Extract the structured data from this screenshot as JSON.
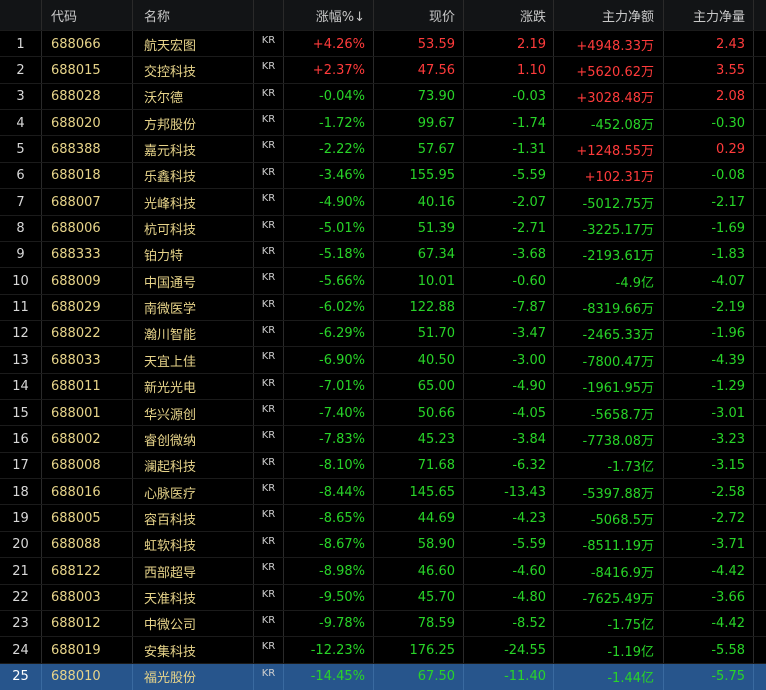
{
  "colors": {
    "up": "#ff3b3b",
    "down": "#28d428",
    "code": "#e7d48a",
    "selected_row": "#27558c",
    "background": "#000000"
  },
  "header": {
    "code": "代码",
    "name": "名称",
    "pct": "涨幅%↓",
    "price": "现价",
    "chg": "涨跌",
    "net": "主力净额",
    "vol": "主力净量"
  },
  "selected_index": 24,
  "rows": [
    {
      "idx": "1",
      "code": "688066",
      "name": "航天宏图",
      "tag": "KR",
      "pct": "+4.26%",
      "price": "53.59",
      "chg": "2.19",
      "net": "+4948.33万",
      "vol": "2.43"
    },
    {
      "idx": "2",
      "code": "688015",
      "name": "交控科技",
      "tag": "KR",
      "pct": "+2.37%",
      "price": "47.56",
      "chg": "1.10",
      "net": "+5620.62万",
      "vol": "3.55"
    },
    {
      "idx": "3",
      "code": "688028",
      "name": "沃尔德",
      "tag": "KR",
      "pct": "-0.04%",
      "price": "73.90",
      "chg": "-0.03",
      "net": "+3028.48万",
      "vol": "2.08"
    },
    {
      "idx": "4",
      "code": "688020",
      "name": "方邦股份",
      "tag": "KR",
      "pct": "-1.72%",
      "price": "99.67",
      "chg": "-1.74",
      "net": "-452.08万",
      "vol": "-0.30"
    },
    {
      "idx": "5",
      "code": "688388",
      "name": "嘉元科技",
      "tag": "KR",
      "pct": "-2.22%",
      "price": "57.67",
      "chg": "-1.31",
      "net": "+1248.55万",
      "vol": "0.29"
    },
    {
      "idx": "6",
      "code": "688018",
      "name": "乐鑫科技",
      "tag": "KR",
      "pct": "-3.46%",
      "price": "155.95",
      "chg": "-5.59",
      "net": "+102.31万",
      "vol": "-0.08"
    },
    {
      "idx": "7",
      "code": "688007",
      "name": "光峰科技",
      "tag": "KR",
      "pct": "-4.90%",
      "price": "40.16",
      "chg": "-2.07",
      "net": "-5012.75万",
      "vol": "-2.17"
    },
    {
      "idx": "8",
      "code": "688006",
      "name": "杭可科技",
      "tag": "KR",
      "pct": "-5.01%",
      "price": "51.39",
      "chg": "-2.71",
      "net": "-3225.17万",
      "vol": "-1.69"
    },
    {
      "idx": "9",
      "code": "688333",
      "name": "铂力特",
      "tag": "KR",
      "pct": "-5.18%",
      "price": "67.34",
      "chg": "-3.68",
      "net": "-2193.61万",
      "vol": "-1.83"
    },
    {
      "idx": "10",
      "code": "688009",
      "name": "中国通号",
      "tag": "KR",
      "pct": "-5.66%",
      "price": "10.01",
      "chg": "-0.60",
      "net": "-4.9亿",
      "vol": "-4.07"
    },
    {
      "idx": "11",
      "code": "688029",
      "name": "南微医学",
      "tag": "KR",
      "pct": "-6.02%",
      "price": "122.88",
      "chg": "-7.87",
      "net": "-8319.66万",
      "vol": "-2.19"
    },
    {
      "idx": "12",
      "code": "688022",
      "name": "瀚川智能",
      "tag": "KR",
      "pct": "-6.29%",
      "price": "51.70",
      "chg": "-3.47",
      "net": "-2465.33万",
      "vol": "-1.96"
    },
    {
      "idx": "13",
      "code": "688033",
      "name": "天宜上佳",
      "tag": "KR",
      "pct": "-6.90%",
      "price": "40.50",
      "chg": "-3.00",
      "net": "-7800.47万",
      "vol": "-4.39"
    },
    {
      "idx": "14",
      "code": "688011",
      "name": "新光光电",
      "tag": "KR",
      "pct": "-7.01%",
      "price": "65.00",
      "chg": "-4.90",
      "net": "-1961.95万",
      "vol": "-1.29"
    },
    {
      "idx": "15",
      "code": "688001",
      "name": "华兴源创",
      "tag": "KR",
      "pct": "-7.40%",
      "price": "50.66",
      "chg": "-4.05",
      "net": "-5658.7万",
      "vol": "-3.01"
    },
    {
      "idx": "16",
      "code": "688002",
      "name": "睿创微纳",
      "tag": "KR",
      "pct": "-7.83%",
      "price": "45.23",
      "chg": "-3.84",
      "net": "-7738.08万",
      "vol": "-3.23"
    },
    {
      "idx": "17",
      "code": "688008",
      "name": "澜起科技",
      "tag": "KR",
      "pct": "-8.10%",
      "price": "71.68",
      "chg": "-6.32",
      "net": "-1.73亿",
      "vol": "-3.15"
    },
    {
      "idx": "18",
      "code": "688016",
      "name": "心脉医疗",
      "tag": "KR",
      "pct": "-8.44%",
      "price": "145.65",
      "chg": "-13.43",
      "net": "-5397.88万",
      "vol": "-2.58"
    },
    {
      "idx": "19",
      "code": "688005",
      "name": "容百科技",
      "tag": "KR",
      "pct": "-8.65%",
      "price": "44.69",
      "chg": "-4.23",
      "net": "-5068.5万",
      "vol": "-2.72"
    },
    {
      "idx": "20",
      "code": "688088",
      "name": "虹软科技",
      "tag": "KR",
      "pct": "-8.67%",
      "price": "58.90",
      "chg": "-5.59",
      "net": "-8511.19万",
      "vol": "-3.71"
    },
    {
      "idx": "21",
      "code": "688122",
      "name": "西部超导",
      "tag": "KR",
      "pct": "-8.98%",
      "price": "46.60",
      "chg": "-4.60",
      "net": "-8416.9万",
      "vol": "-4.42"
    },
    {
      "idx": "22",
      "code": "688003",
      "name": "天准科技",
      "tag": "KR",
      "pct": "-9.50%",
      "price": "45.70",
      "chg": "-4.80",
      "net": "-7625.49万",
      "vol": "-3.66"
    },
    {
      "idx": "23",
      "code": "688012",
      "name": "中微公司",
      "tag": "KR",
      "pct": "-9.78%",
      "price": "78.59",
      "chg": "-8.52",
      "net": "-1.75亿",
      "vol": "-4.42"
    },
    {
      "idx": "24",
      "code": "688019",
      "name": "安集科技",
      "tag": "KR",
      "pct": "-12.23%",
      "price": "176.25",
      "chg": "-24.55",
      "net": "-1.19亿",
      "vol": "-5.58"
    },
    {
      "idx": "25",
      "code": "688010",
      "name": "福光股份",
      "tag": "KR",
      "pct": "-14.45%",
      "price": "67.50",
      "chg": "-11.40",
      "net": "-1.44亿",
      "vol": "-5.75"
    }
  ]
}
